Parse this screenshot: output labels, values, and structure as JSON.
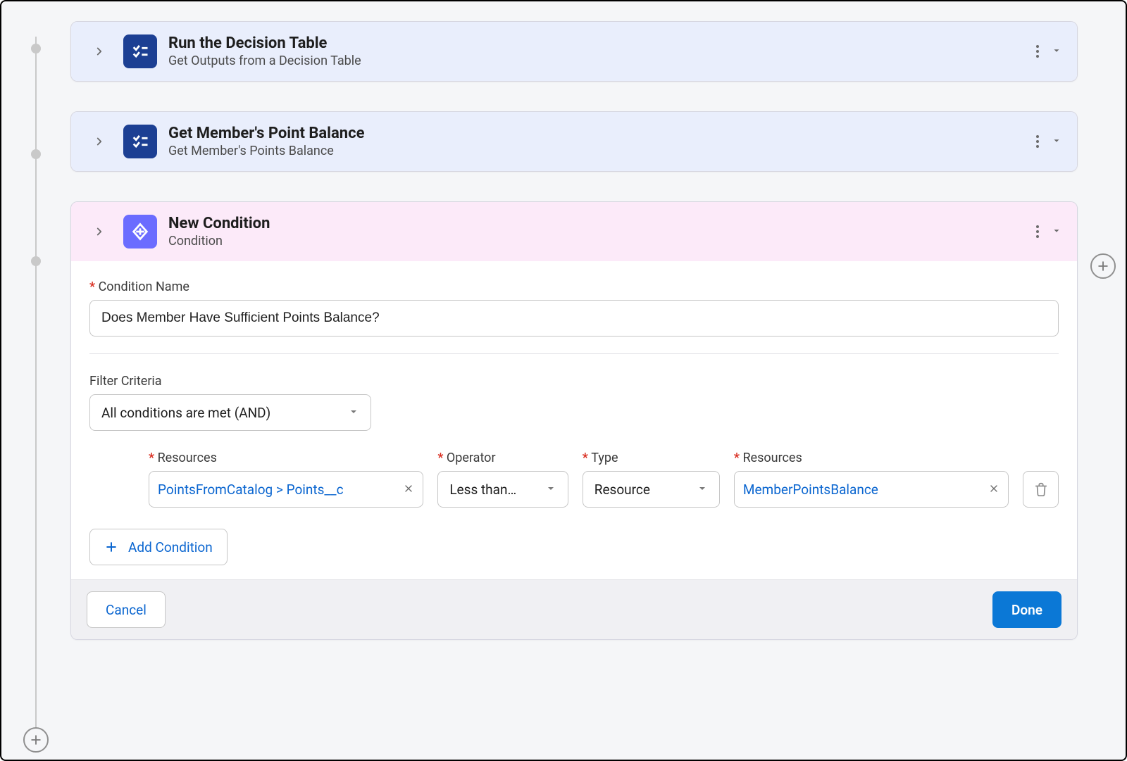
{
  "steps": [
    {
      "title": "Run the Decision Table",
      "subtitle": "Get Outputs from a Decision Table"
    },
    {
      "title": "Get Member's Point Balance",
      "subtitle": "Get Member's Points Balance"
    },
    {
      "title": "New Condition",
      "subtitle": "Condition"
    }
  ],
  "condition": {
    "name_label": "Condition Name",
    "name_value": "Does Member Have Sufficient Points Balance?",
    "filter_label": "Filter Criteria",
    "filter_value": "All conditions are met (AND)",
    "columns": {
      "resources": "Resources",
      "operator": "Operator",
      "type": "Type",
      "resources2": "Resources"
    },
    "row": {
      "resource1": "PointsFromCatalog > Points__c",
      "operator": "Less than…",
      "type": "Resource",
      "resource2": "MemberPointsBalance"
    },
    "add_condition_label": "Add Condition"
  },
  "footer": {
    "cancel": "Cancel",
    "done": "Done"
  }
}
